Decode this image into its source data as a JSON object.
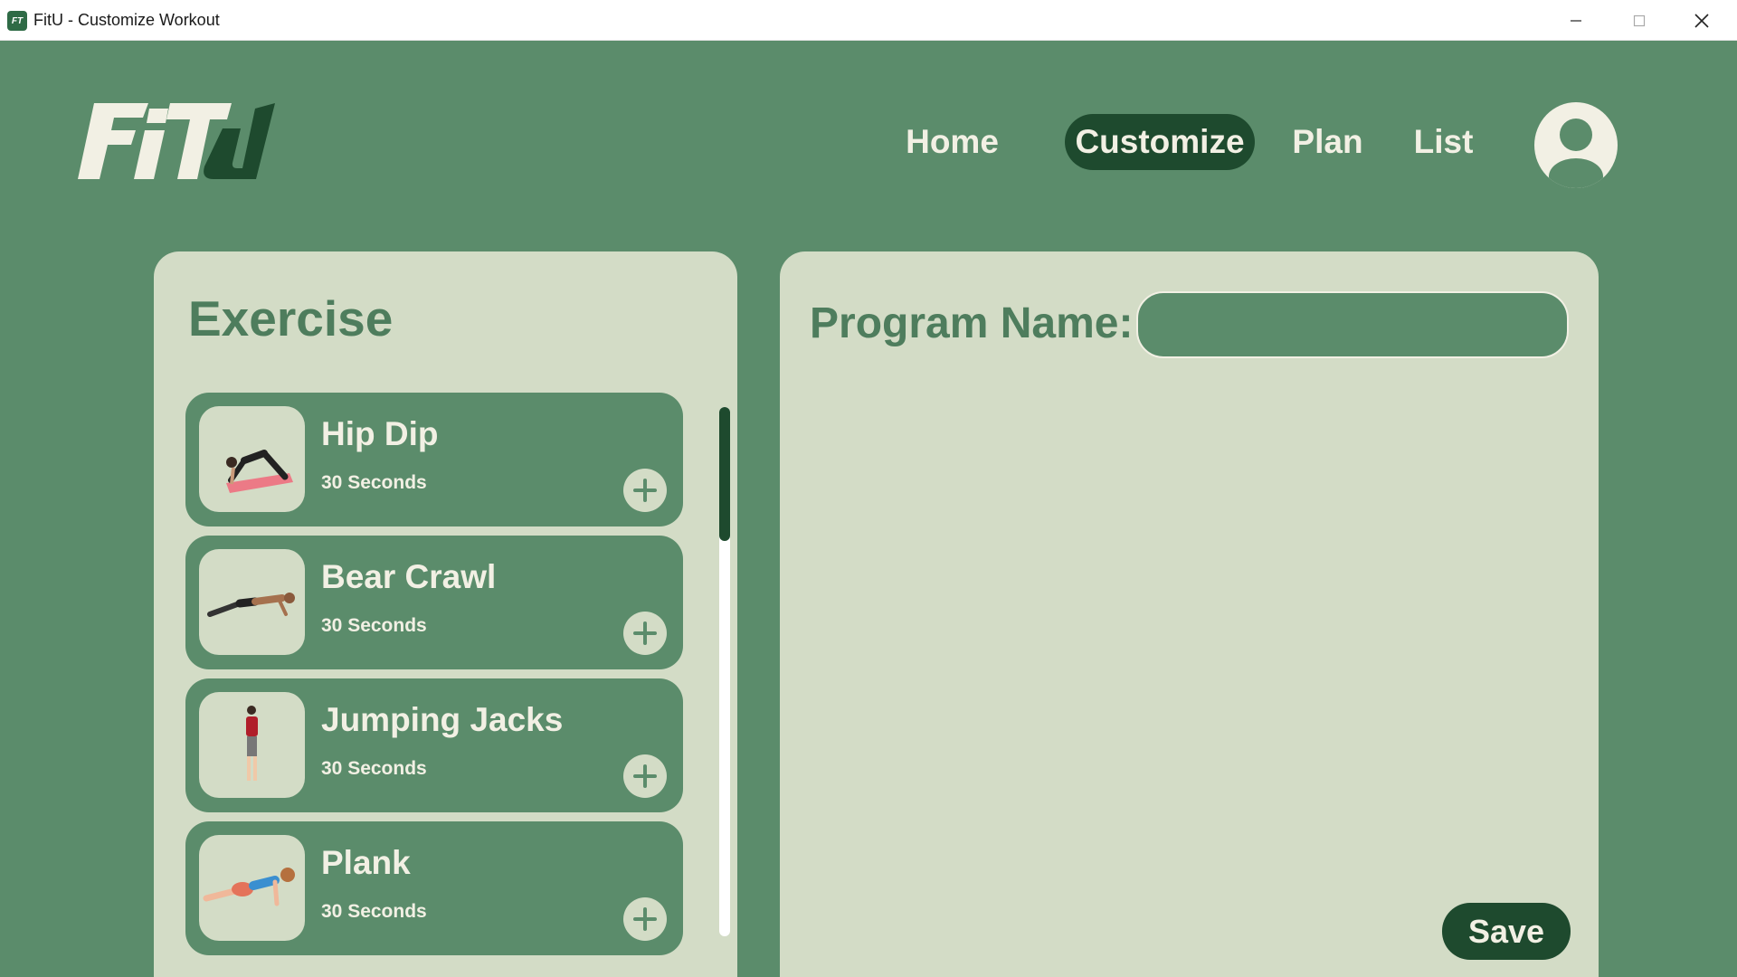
{
  "window": {
    "title": "FitU - Customize Workout",
    "app_icon_text": "FitU",
    "controls": [
      "minimize",
      "maximize",
      "close"
    ]
  },
  "header": {
    "logo_text": "FitU",
    "nav": [
      {
        "label": "Home",
        "active": false
      },
      {
        "label": "Customize",
        "active": true
      },
      {
        "label": "Plan",
        "active": false
      },
      {
        "label": "List",
        "active": false
      }
    ],
    "avatar_icon": "user-icon"
  },
  "exercise_panel": {
    "heading": "Exercise",
    "items": [
      {
        "name": "Hip Dip",
        "duration": "30 Seconds",
        "image": "hip-dip-figure",
        "action_icon": "plus-icon"
      },
      {
        "name": "Bear Crawl",
        "duration": "30 Seconds",
        "image": "bear-crawl-figure",
        "action_icon": "plus-icon"
      },
      {
        "name": "Jumping Jacks",
        "duration": "30 Seconds",
        "image": "jumping-jacks-figure",
        "action_icon": "plus-icon"
      },
      {
        "name": "Plank",
        "duration": "30 Seconds",
        "image": "plank-figure",
        "action_icon": "plus-icon"
      }
    ]
  },
  "program_panel": {
    "label": "Program Name:",
    "input_value": "",
    "input_placeholder": "",
    "save_label": "Save"
  },
  "colors": {
    "background": "#5b8c6b",
    "panel": "#d3dcc6",
    "accent_dark": "#1e4a2e",
    "text_light": "#f2f0e4",
    "heading_green": "#4e7d5d"
  }
}
